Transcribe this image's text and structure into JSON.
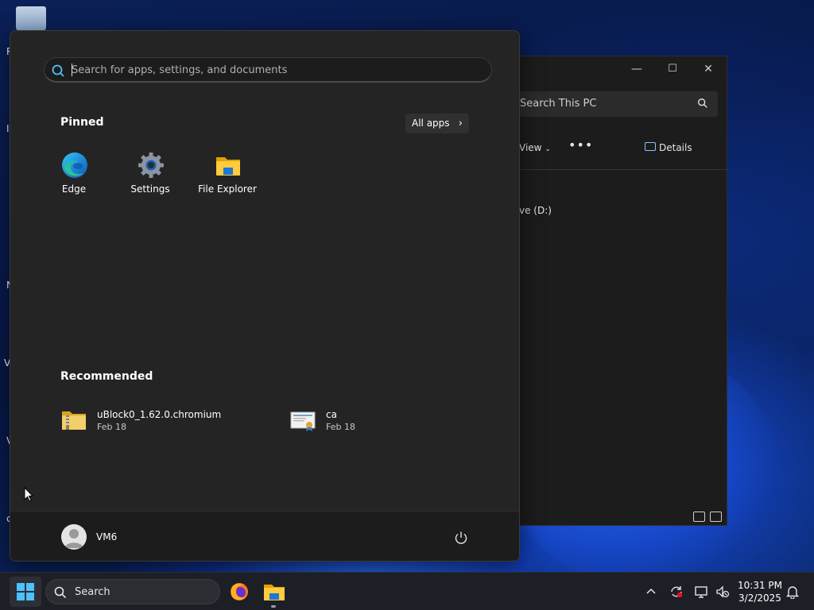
{
  "desktop": {
    "side_letters": [
      "R",
      "I",
      "N",
      "V",
      "V",
      "c"
    ]
  },
  "explorer": {
    "search_placeholder": "Search This PC",
    "view_label": "View",
    "more_label": "•••",
    "details_label": "Details",
    "drive_label": "ve (D:)",
    "window_buttons": {
      "minimize": "—",
      "maximize": "☐",
      "close": "✕"
    }
  },
  "start_menu": {
    "search_placeholder": "Search for apps, settings, and documents",
    "pinned_title": "Pinned",
    "all_apps_label": "All apps",
    "pinned_apps": [
      {
        "label": "Edge",
        "icon": "edge-icon"
      },
      {
        "label": "Settings",
        "icon": "settings-gear-icon"
      },
      {
        "label": "File Explorer",
        "icon": "folder-icon"
      }
    ],
    "recommended_title": "Recommended",
    "recommended": [
      {
        "name": "uBlock0_1.62.0.chromium",
        "date": "Feb 18",
        "icon": "zip-folder-icon"
      },
      {
        "name": "ca",
        "date": "Feb 18",
        "icon": "certificate-icon"
      }
    ],
    "user_name": "VM6"
  },
  "taskbar": {
    "search_label": "Search",
    "time": "10:31 PM",
    "date": "3/2/2025"
  },
  "colors": {
    "start_bg": "#242424",
    "accent": "#0078d4",
    "taskbar_bg": "#1d1f26"
  }
}
